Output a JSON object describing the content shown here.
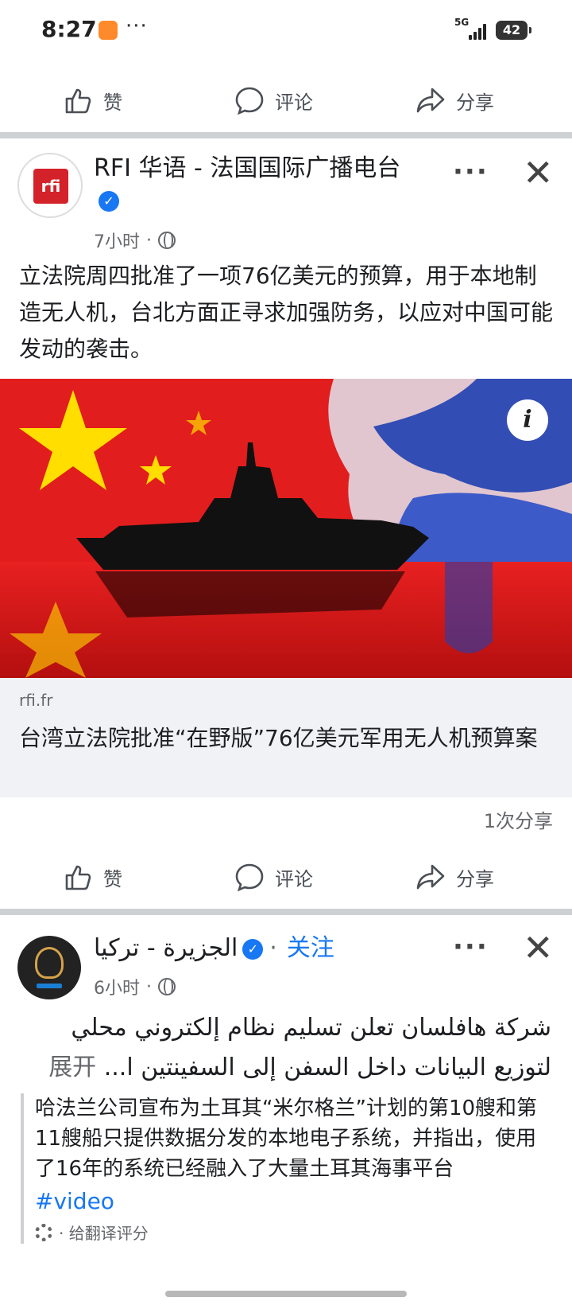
{
  "status_bar": {
    "time": "8:27",
    "dots": "···",
    "network": "5G",
    "battery": "42"
  },
  "top_actions": {
    "like": "赞",
    "comment": "评论",
    "share": "分享"
  },
  "post1": {
    "author": "RFI 华语 - 法国国际广播电台",
    "time": "7小时",
    "text": "立法院周四批准了一项76亿美元的预算，用于本地制造无人机，台北方面正寻求加强防务，以应对中国可能发动的袭击。",
    "link_domain": "rfi.fr",
    "link_title": "台湾立法院批准“在野版”76亿美元军用无人机预算案",
    "shares": "1次分享",
    "actions": {
      "like": "赞",
      "comment": "评论",
      "share": "分享"
    },
    "avatar_text": "rfi"
  },
  "post2": {
    "author": "الجزيرة - تركيا",
    "follow": "关注",
    "time": "6小时",
    "arabic_line1": "شركة هافلسان تعلن تسليم نظام إلكتروني محلي",
    "arabic_line2": "لتوزيع البيانات داخل السفن إلى السفينتين ا...",
    "expand": "展开",
    "translation": "哈法兰公司宣布为土耳其“米尔格兰”计划的第10艘和第11艘船只提供数据分发的本地电子系统，并指出，使用了16年的系统已经融入了大量土耳其海事平台",
    "hashtag": "#video",
    "rate_translation": "· 给翻译评分"
  },
  "colors": {
    "link_blue": "#1877f2",
    "gray_text": "#65676b",
    "flag_red": "#e21d1d"
  }
}
